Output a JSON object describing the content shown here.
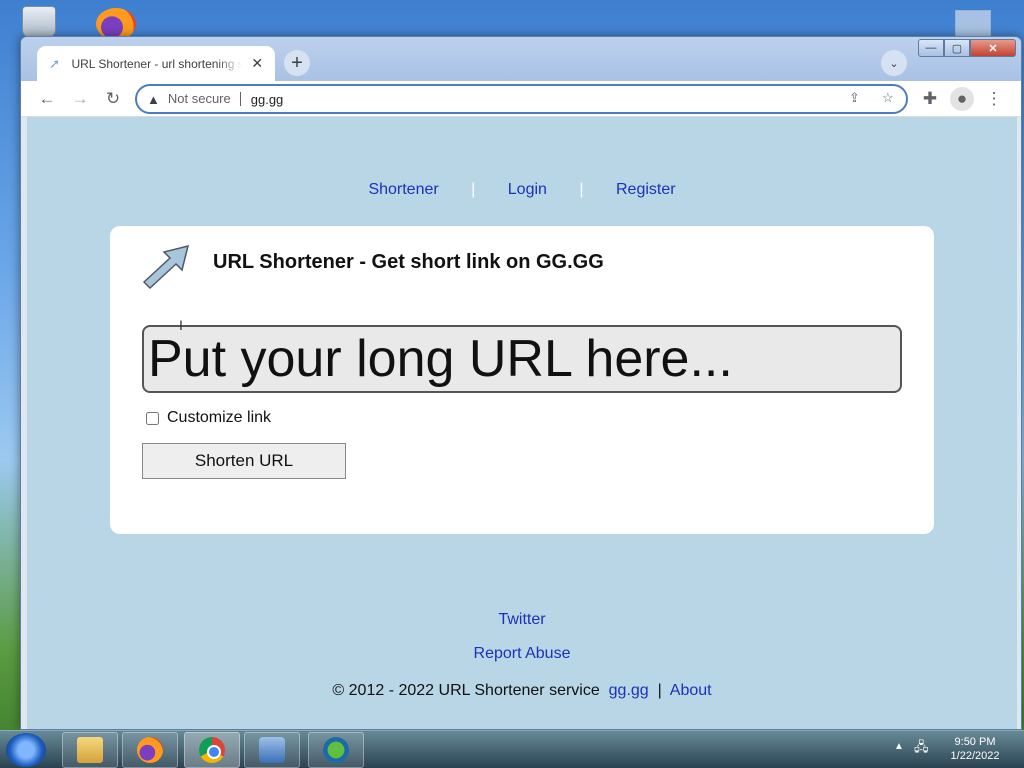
{
  "browser": {
    "tab_title": "URL Shortener - url shortening s",
    "tab_close": "✕",
    "new_tab": "+",
    "tab_list": "⌄",
    "security_label": "Not secure",
    "url": "gg.gg",
    "window_controls": {
      "minimize": "—",
      "maximize": "▢",
      "close": "✕"
    }
  },
  "nav": {
    "shortener": "Shortener",
    "login": "Login",
    "register": "Register",
    "separator": "|"
  },
  "card": {
    "title": "URL Shortener - Get short link on GG.GG",
    "input_placeholder": "Put your long URL here...",
    "customize_label": "Customize link",
    "shorten_button": "Shorten URL"
  },
  "footer": {
    "twitter": "Twitter",
    "report": "Report Abuse",
    "copyright": "© 2012 - 2022 URL Shortener service",
    "site_link": "gg.gg",
    "pipe": "|",
    "about": "About"
  },
  "taskbar": {
    "time": "9:50 PM",
    "date": "1/22/2022"
  },
  "colors": {
    "page_bg": "#b8d6e6",
    "link": "#1a33b8"
  }
}
